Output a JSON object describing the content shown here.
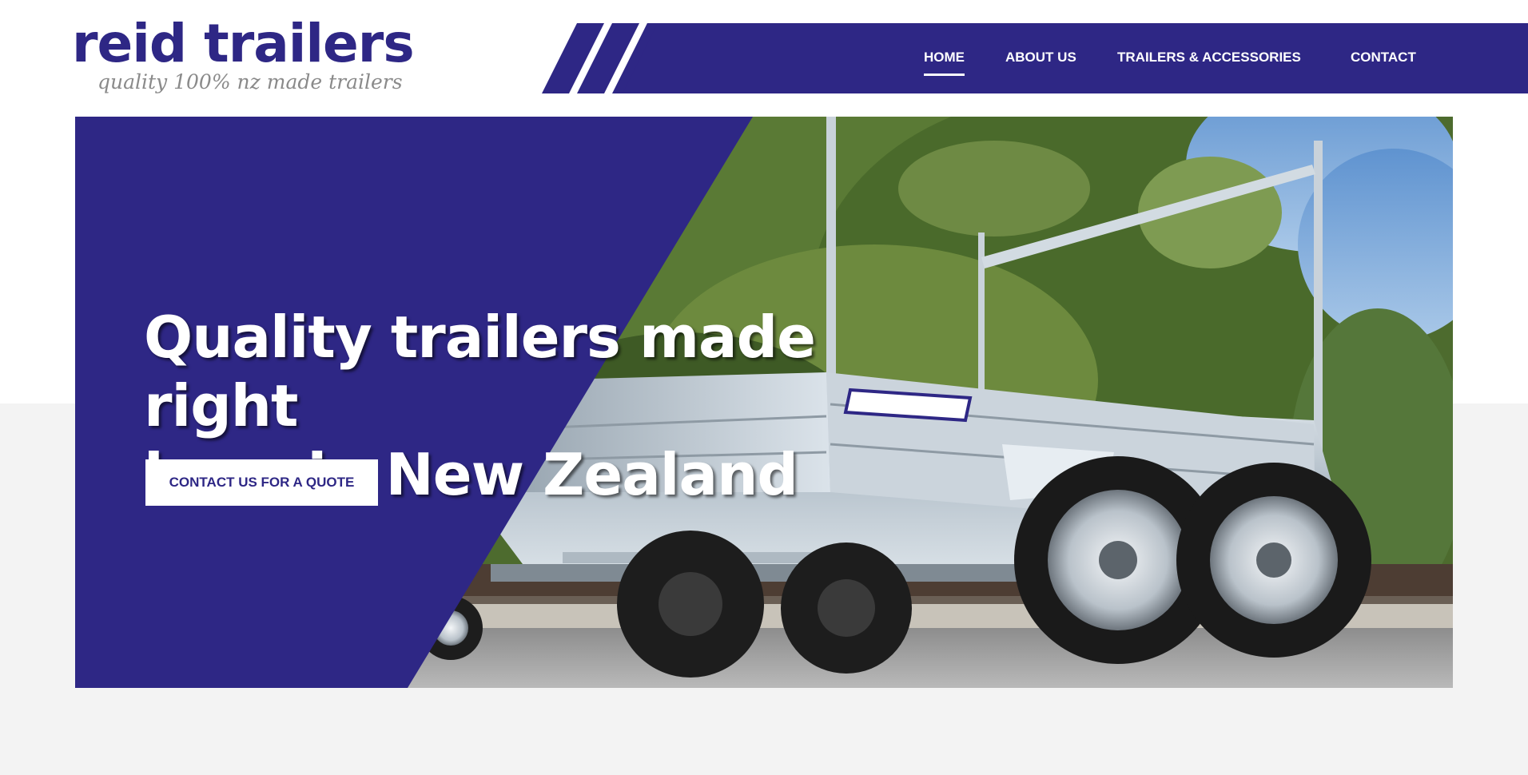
{
  "brand": {
    "name": "reid trailers",
    "tagline": "quality 100% nz made trailers",
    "primary_color": "#2e2785",
    "accent_white": "#ffffff"
  },
  "nav": {
    "items": [
      {
        "label": "HOME",
        "active": true
      },
      {
        "label": "ABOUT US",
        "active": false
      },
      {
        "label": "TRAILERS & ACCESSORIES",
        "active": false
      },
      {
        "label": "CONTACT",
        "active": false
      }
    ]
  },
  "hero": {
    "heading_line1": "Quality trailers made right",
    "heading_line2": "here in New Zealand",
    "cta_label": "CONTACT US FOR A QUOTE",
    "image_subject": "galvanised tandem-axle trailer with ladder rack",
    "trailer_decal": "reid trailers"
  }
}
